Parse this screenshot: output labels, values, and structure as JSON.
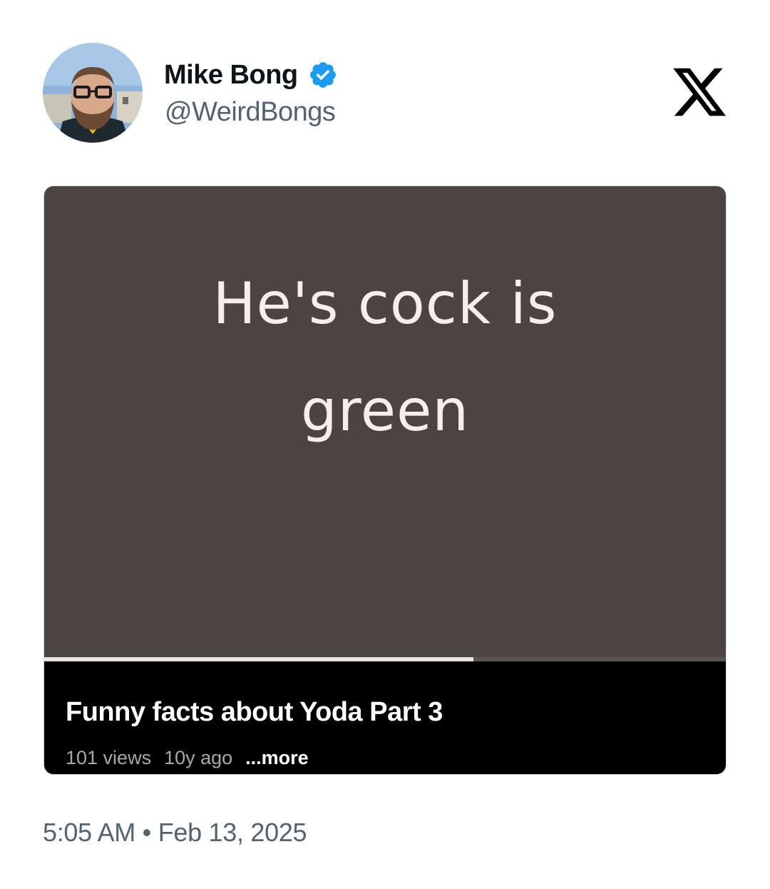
{
  "author": {
    "display_name": "Mike Bong",
    "handle": "@WeirdBongs",
    "verified_icon": "verified-badge-icon",
    "verified_color": "#1d9bf0"
  },
  "brand_icon": "x-logo-icon",
  "media": {
    "caption_line1": "He's cock is",
    "caption_line2": "green",
    "frame_color": "#4b4440",
    "progress": 0.63,
    "video_title": "Funny facts about Yoda Part 3",
    "views": "101 views",
    "age": "10y ago",
    "more_label": "...more"
  },
  "timestamp": "5:05 AM • Feb 13, 2025"
}
